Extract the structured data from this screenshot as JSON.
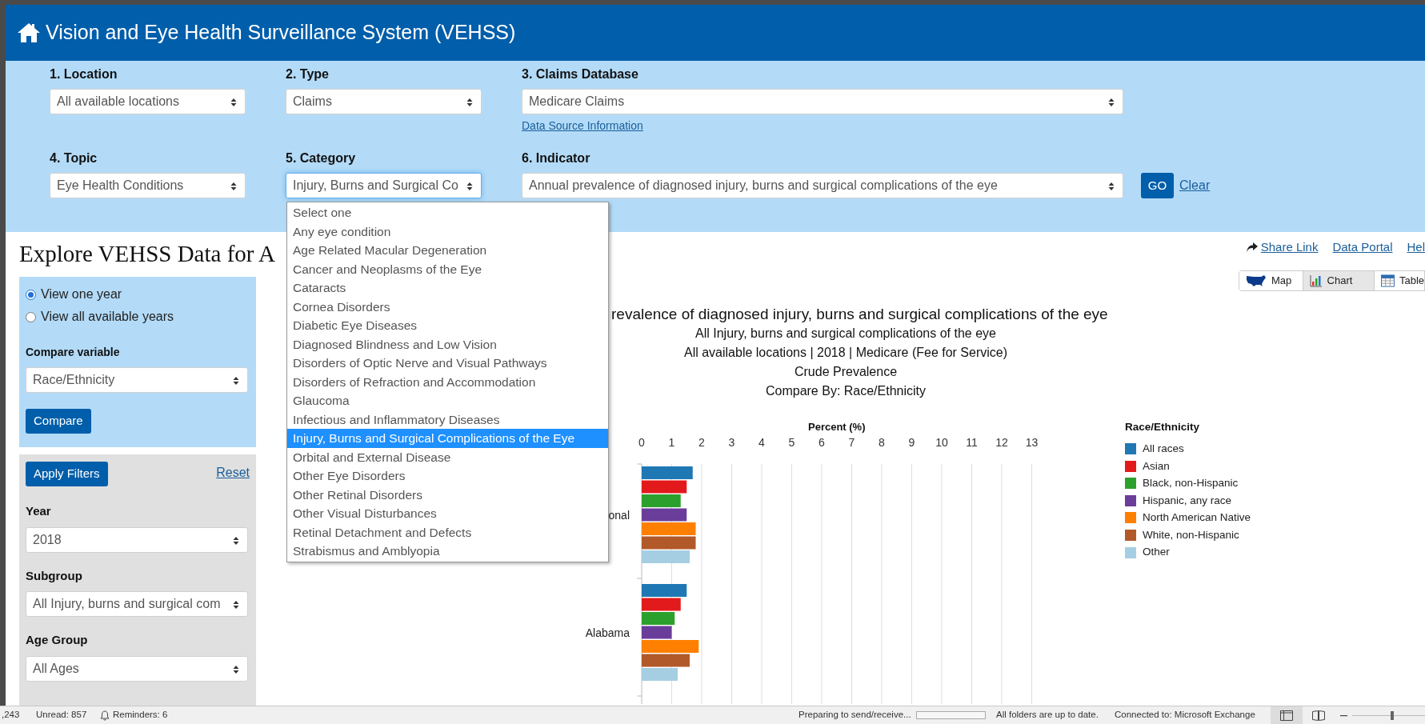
{
  "header": {
    "title": "Vision and Eye Health Surveillance System (VEHSS)"
  },
  "filters": [
    {
      "label": "1. Location",
      "value": "All available locations",
      "focused": false,
      "kind": "narrow"
    },
    {
      "label": "2. Type",
      "value": "Claims",
      "focused": false,
      "kind": "narrow"
    },
    {
      "label": "3. Claims Database",
      "value": "Medicare Claims",
      "focused": false,
      "kind": "wide",
      "link": "Data Source Information"
    },
    {
      "label": "4. Topic",
      "value": "Eye Health Conditions",
      "focused": false,
      "kind": "narrow"
    },
    {
      "label": "5. Category",
      "value": "Injury, Burns and Surgical Co",
      "focused": true,
      "kind": "narrow"
    },
    {
      "label": "6. Indicator",
      "value": "Annual prevalence of diagnosed injury, burns and surgical complications of the eye",
      "focused": false,
      "kind": "wide"
    }
  ],
  "go_button": "GO",
  "clear_link": "Clear",
  "category_dropdown": [
    {
      "label": "Select one",
      "selected": false
    },
    {
      "label": "Any eye condition",
      "selected": false
    },
    {
      "label": "Age Related Macular Degeneration",
      "selected": false
    },
    {
      "label": "Cancer and Neoplasms of the Eye",
      "selected": false
    },
    {
      "label": "Cataracts",
      "selected": false
    },
    {
      "label": "Cornea Disorders",
      "selected": false
    },
    {
      "label": "Diabetic Eye Diseases",
      "selected": false
    },
    {
      "label": "Diagnosed Blindness and Low Vision",
      "selected": false
    },
    {
      "label": "Disorders of Optic Nerve and Visual Pathways",
      "selected": false
    },
    {
      "label": "Disorders of Refraction and Accommodation",
      "selected": false
    },
    {
      "label": "Glaucoma",
      "selected": false
    },
    {
      "label": "Infectious and Inflammatory Diseases",
      "selected": false
    },
    {
      "label": "Injury, Burns and Surgical Complications of the Eye",
      "selected": true
    },
    {
      "label": "Orbital and External Disease",
      "selected": false
    },
    {
      "label": "Other Eye Disorders",
      "selected": false
    },
    {
      "label": "Other Retinal Disorders",
      "selected": false
    },
    {
      "label": "Other Visual Disturbances",
      "selected": false
    },
    {
      "label": "Retinal Detachment and Defects",
      "selected": false
    },
    {
      "label": "Strabismus and Amblyopia",
      "selected": false
    }
  ],
  "page_title": "Explore VEHSS Data for A",
  "top_links": [
    {
      "label": "Share Link",
      "kind": "share"
    },
    {
      "label": "Data Portal",
      "kind": "plain"
    },
    {
      "label": "Hel",
      "kind": "plain"
    }
  ],
  "view_tabs": [
    {
      "label": "Map",
      "kind": "map",
      "selected": false
    },
    {
      "label": "Chart",
      "kind": "chart",
      "selected": true
    },
    {
      "label": "Table",
      "kind": "table",
      "selected": false
    }
  ],
  "view_options": [
    {
      "label": "View one year",
      "selected": true
    },
    {
      "label": "View all available years",
      "selected": false
    }
  ],
  "compare": {
    "label": "Compare variable",
    "value": "Race/Ethnicity",
    "button": "Compare"
  },
  "filter_panel": {
    "apply_button": "Apply Filters",
    "reset_link": "Reset",
    "fields": [
      {
        "label": "Year",
        "value": "2018"
      },
      {
        "label": "Subgroup",
        "value": "All Injury, burns and surgical com"
      },
      {
        "label": "Age Group",
        "value": "All Ages"
      }
    ]
  },
  "chart": {
    "title": "revalence of diagnosed injury, burns and surgical complications of the eye",
    "subtitles": [
      "All Injury, burns and surgical complications of the eye",
      "All available locations | 2018 | Medicare (Fee for Service)",
      "Crude Prevalence",
      "Compare By: Race/Ethnicity"
    ],
    "legend_title": "Race/Ethnicity",
    "chart_data": {
      "type": "bar",
      "orientation": "horizontal",
      "xlabel": "Percent (%)",
      "categories": [
        "onal",
        "Alabama"
      ],
      "xticks": [
        0,
        1,
        2,
        3,
        4,
        5,
        6,
        7,
        8,
        9,
        10,
        11,
        12,
        13
      ],
      "xlim": [
        0,
        13
      ],
      "grid": true,
      "series": [
        {
          "name": "All races",
          "color": "#1f77b4",
          "values": [
            1.7,
            1.5
          ]
        },
        {
          "name": "Asian",
          "color": "#e31a1c",
          "values": [
            1.5,
            1.3
          ]
        },
        {
          "name": "Black, non-Hispanic",
          "color": "#2ca02c",
          "values": [
            1.3,
            1.1
          ]
        },
        {
          "name": "Hispanic, any race",
          "color": "#6a3d9a",
          "values": [
            1.5,
            1.0
          ]
        },
        {
          "name": "North American Native",
          "color": "#ff7f00",
          "values": [
            1.8,
            1.9
          ]
        },
        {
          "name": "White, non-Hispanic",
          "color": "#b15928",
          "values": [
            1.8,
            1.6
          ]
        },
        {
          "name": "Other",
          "color": "#a6cee3",
          "values": [
            1.6,
            1.2
          ]
        }
      ]
    }
  },
  "status_bar": {
    "count": ",243",
    "unread": "Unread: 857",
    "reminders": "Reminders: 6",
    "send_status": "Preparing to send/receive...",
    "folders": "All folders are up to date.",
    "connection": "Connected to: Microsoft Exchange",
    "progress": {
      "level": 0
    },
    "zoom": {
      "level": 0.5
    }
  }
}
